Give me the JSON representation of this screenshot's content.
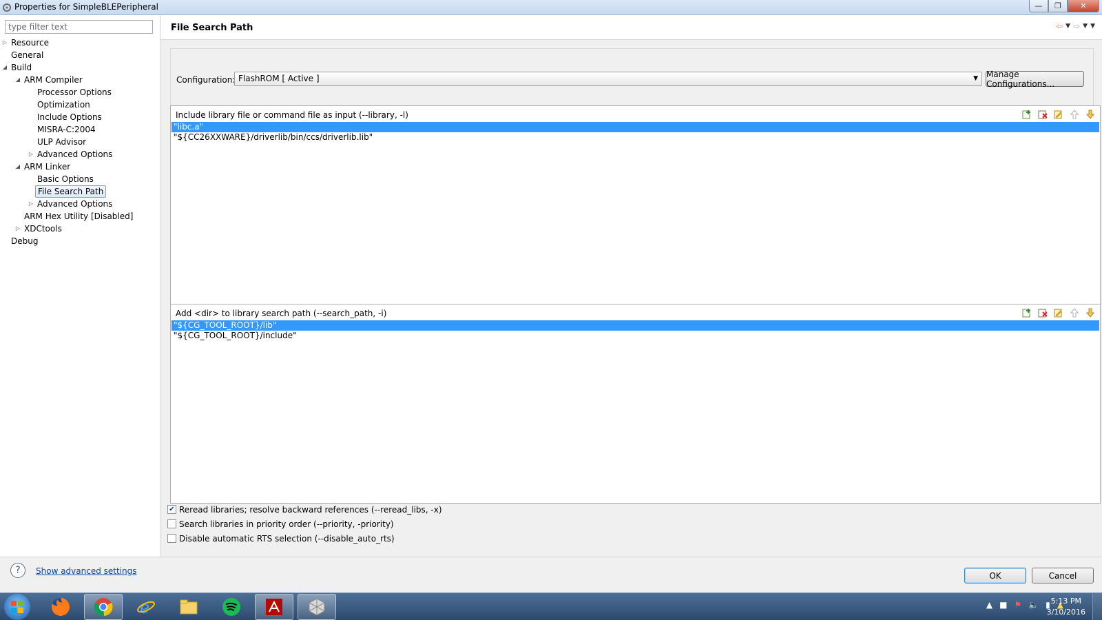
{
  "window": {
    "title": "Properties for SimpleBLEPeripheral"
  },
  "sidebar": {
    "filter_placeholder": "type filter text",
    "tree": [
      {
        "label": "Resource",
        "level": 0,
        "expander": "collapsed"
      },
      {
        "label": "General",
        "level": 0,
        "expander": "none"
      },
      {
        "label": "Build",
        "level": 0,
        "expander": "expanded"
      },
      {
        "label": "ARM Compiler",
        "level": 1,
        "expander": "expanded"
      },
      {
        "label": "Processor Options",
        "level": 2,
        "expander": "none"
      },
      {
        "label": "Optimization",
        "level": 2,
        "expander": "none"
      },
      {
        "label": "Include Options",
        "level": 2,
        "expander": "none"
      },
      {
        "label": "MISRA-C:2004",
        "level": 2,
        "expander": "none"
      },
      {
        "label": "ULP Advisor",
        "level": 2,
        "expander": "none"
      },
      {
        "label": "Advanced Options",
        "level": 2,
        "expander": "collapsed"
      },
      {
        "label": "ARM Linker",
        "level": 1,
        "expander": "expanded"
      },
      {
        "label": "Basic Options",
        "level": 2,
        "expander": "none"
      },
      {
        "label": "File Search Path",
        "level": 2,
        "expander": "none",
        "selected": true
      },
      {
        "label": "Advanced Options",
        "level": 2,
        "expander": "collapsed"
      },
      {
        "label": "ARM Hex Utility  [Disabled]",
        "level": 1,
        "expander": "none"
      },
      {
        "label": "XDCtools",
        "level": 1,
        "expander": "collapsed"
      },
      {
        "label": "Debug",
        "level": 0,
        "expander": "none"
      }
    ]
  },
  "page": {
    "title": "File Search Path",
    "configuration_label": "Configuration:",
    "configuration_value": "FlashROM  [ Active ]",
    "manage_button": "Manage Configurations..."
  },
  "library_panel": {
    "header": "Include library file or command file as input (--library, -l)",
    "items": [
      {
        "text": "\"libc.a\"",
        "selected": true
      },
      {
        "text": "\"${CC26XXWARE}/driverlib/bin/ccs/driverlib.lib\"",
        "selected": false
      }
    ]
  },
  "search_path_panel": {
    "header": "Add <dir> to library search path (--search_path, -i)",
    "items": [
      {
        "text": "\"${CG_TOOL_ROOT}/lib\"",
        "selected": true
      },
      {
        "text": "\"${CG_TOOL_ROOT}/include\"",
        "selected": false
      }
    ]
  },
  "options": [
    {
      "label": "Reread libraries; resolve backward references (--reread_libs, -x)",
      "checked": true
    },
    {
      "label": "Search libraries in priority order (--priority, -priority)",
      "checked": false
    },
    {
      "label": "Disable automatic RTS selection (--disable_auto_rts)",
      "checked": false
    }
  ],
  "footer": {
    "advanced_link": "Show advanced settings",
    "ok": "OK",
    "cancel": "Cancel"
  },
  "taskbar": {
    "apps": [
      "firefox-icon",
      "chrome-icon",
      "internet-explorer-icon",
      "file-explorer-icon",
      "spotify-icon",
      "acrobat-icon",
      "ccs-icon"
    ],
    "time": "5:13 PM",
    "date": "3/10/2016"
  },
  "colors": {
    "selection": "#3399ff",
    "link": "#0645ad"
  }
}
